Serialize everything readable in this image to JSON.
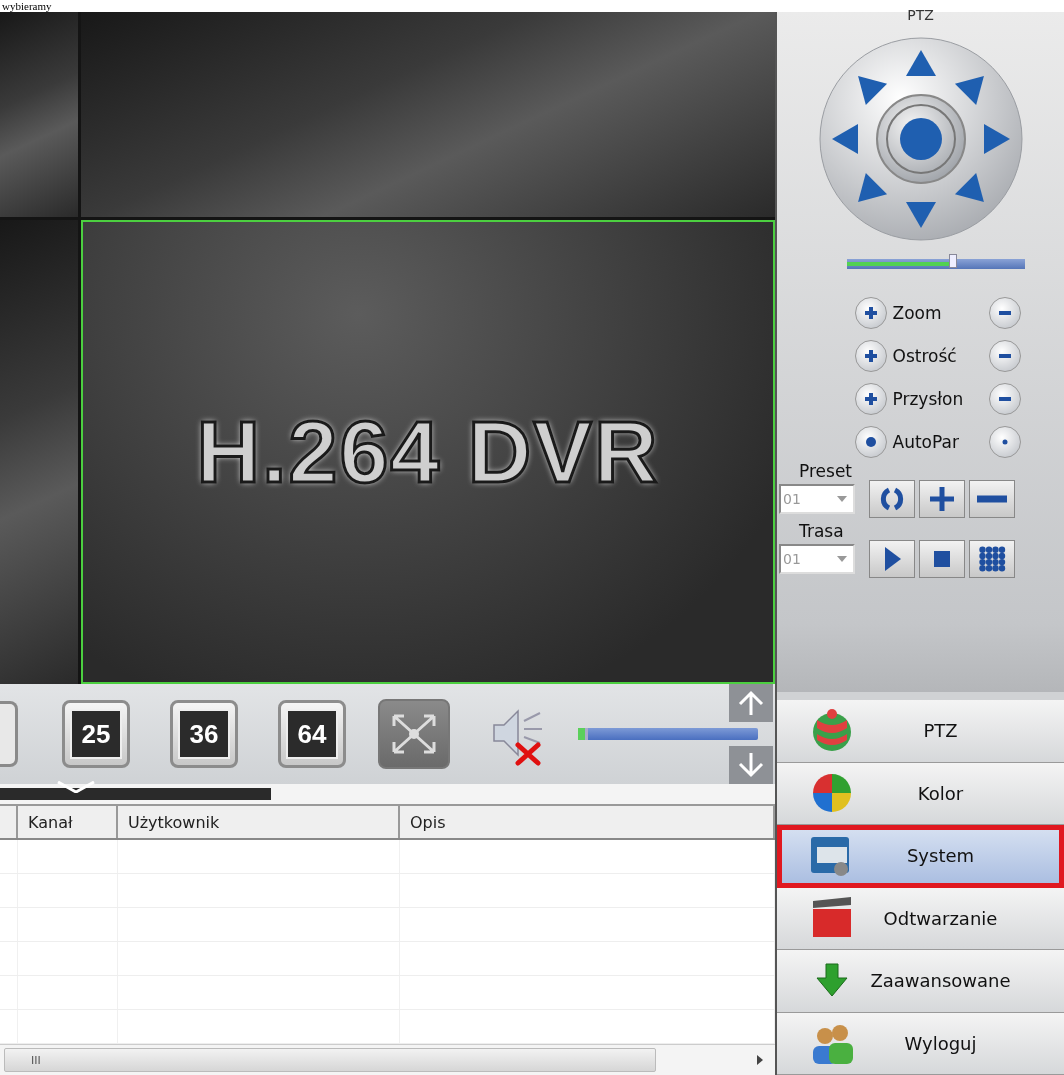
{
  "header": {
    "caption": "wybieramy",
    "panel_title": "PTZ"
  },
  "video": {
    "logo": "H.264 DVR"
  },
  "ptz": {
    "speed": {
      "level": 0.6
    },
    "controls": [
      {
        "label": "Zoom",
        "kind": "plusminus"
      },
      {
        "label": "Ostrość",
        "kind": "plusminus"
      },
      {
        "label": "Przysłon",
        "kind": "plusminus"
      },
      {
        "label": "AutoPar",
        "kind": "dot"
      }
    ],
    "preset": {
      "label": "Preset",
      "value": "01",
      "actions": [
        {
          "kind": "refresh"
        },
        {
          "kind": "add"
        },
        {
          "kind": "remove"
        }
      ]
    },
    "route": {
      "label": "Trasa",
      "value": "01",
      "actions": [
        {
          "kind": "play"
        },
        {
          "kind": "stop"
        },
        {
          "kind": "grid"
        }
      ]
    }
  },
  "toolbar": {
    "layouts": [
      "25",
      "36",
      "64"
    ],
    "volume": {
      "muted": true,
      "level": 0.04
    }
  },
  "timeline": {
    "level": 0.35
  },
  "table": {
    "columns": [
      "Kanał",
      "Użytkownik",
      "Opis"
    ],
    "scroll_grip": "III"
  },
  "menu": [
    {
      "label": "PTZ",
      "kind": "ptz",
      "selected": false,
      "marked": false
    },
    {
      "label": "Kolor",
      "kind": "color",
      "selected": false,
      "marked": false
    },
    {
      "label": "System",
      "kind": "system",
      "selected": true,
      "marked": true
    },
    {
      "label": "Odtwarzanie",
      "kind": "playback",
      "selected": false,
      "marked": false
    },
    {
      "label": "Zaawansowane",
      "kind": "advanced",
      "selected": false,
      "marked": false
    },
    {
      "label": "Wyloguj",
      "kind": "logout",
      "selected": false,
      "marked": false
    }
  ]
}
